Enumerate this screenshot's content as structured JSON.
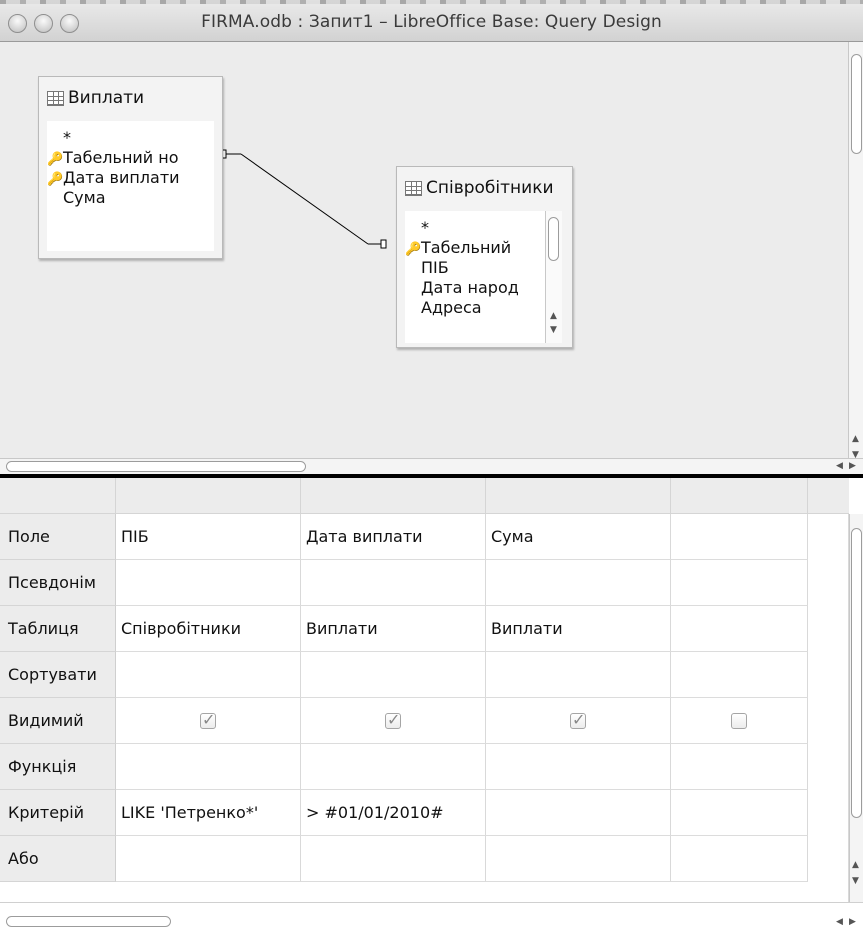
{
  "window": {
    "title": "FIRMA.odb : Запит1 – LibreOffice Base: Query Design"
  },
  "tables": [
    {
      "name": "Виплати",
      "fields": [
        {
          "label": "*",
          "key": false
        },
        {
          "label": "Табельний но",
          "key": true
        },
        {
          "label": "Дата виплати",
          "key": true
        },
        {
          "label": "Сума",
          "key": false
        }
      ]
    },
    {
      "name": "Співробітники",
      "fields": [
        {
          "label": "*",
          "key": false
        },
        {
          "label": "Табельний",
          "key": true
        },
        {
          "label": "ПІБ",
          "key": false
        },
        {
          "label": "Дата народ",
          "key": false
        },
        {
          "label": "Адреса",
          "key": false
        }
      ]
    }
  ],
  "grid": {
    "row_labels": [
      "Поле",
      "Псевдонім",
      "Таблиця",
      "Сортувати",
      "Видимий",
      "Функція",
      "Критерій",
      "Або"
    ],
    "columns": [
      {
        "field": "ПІБ",
        "alias": "",
        "table": "Співробітники",
        "sort": "",
        "visible": true,
        "function": "",
        "criterion": "LIKE 'Петренко*'",
        "or": ""
      },
      {
        "field": "Дата виплати",
        "alias": "",
        "table": "Виплати",
        "sort": "",
        "visible": true,
        "function": "",
        "criterion": "> #01/01/2010#",
        "or": ""
      },
      {
        "field": "Сума",
        "alias": "",
        "table": "Виплати",
        "sort": "",
        "visible": true,
        "function": "",
        "criterion": "",
        "or": ""
      },
      {
        "field": "",
        "alias": "",
        "table": "",
        "sort": "",
        "visible": false,
        "function": "",
        "criterion": "",
        "or": ""
      }
    ]
  }
}
